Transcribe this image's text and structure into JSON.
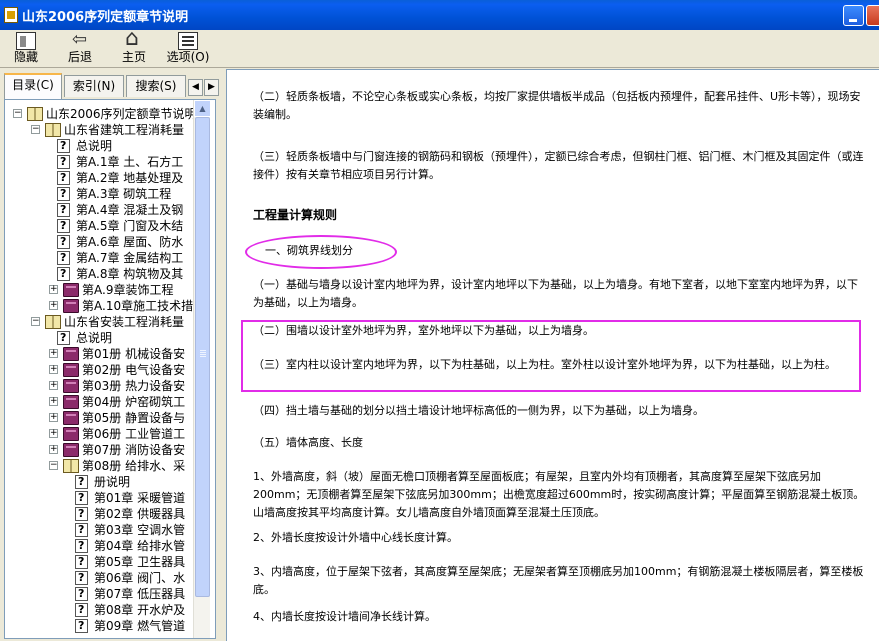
{
  "window": {
    "title": "山东2006序列定额章节说明"
  },
  "toolbar": [
    {
      "label": "隐藏",
      "icon": "hide-pane-icon"
    },
    {
      "label": "后退",
      "icon": "back-arrow-icon"
    },
    {
      "label": "主页",
      "icon": "home-icon"
    },
    {
      "label": "选项(O)",
      "icon": "options-icon"
    }
  ],
  "tabs": [
    {
      "label": "目录(C)",
      "active": true
    },
    {
      "label": "索引(N)",
      "active": false
    },
    {
      "label": "搜索(S)",
      "active": false
    }
  ],
  "tree": [
    {
      "label": "山东2006序列定额章节说明",
      "icon": "book-open",
      "expander": "-",
      "level": 0
    },
    {
      "label": "山东省建筑工程消耗量",
      "icon": "book-open",
      "expander": "-",
      "level": 1
    },
    {
      "label": "总说明",
      "icon": "page",
      "expander": "",
      "level": 2
    },
    {
      "label": "第A.1章 土、石方工",
      "icon": "page",
      "expander": "",
      "level": 2
    },
    {
      "label": "第A.2章 地基处理及",
      "icon": "page",
      "expander": "",
      "level": 2
    },
    {
      "label": "第A.3章 砌筑工程",
      "icon": "page",
      "expander": "",
      "level": 2,
      "selected": true
    },
    {
      "label": "第A.4章 混凝土及钢",
      "icon": "page",
      "expander": "",
      "level": 2
    },
    {
      "label": "第A.5章 门窗及木结",
      "icon": "page",
      "expander": "",
      "level": 2
    },
    {
      "label": "第A.6章 屋面、防水",
      "icon": "page",
      "expander": "",
      "level": 2
    },
    {
      "label": "第A.7章 金属结构工",
      "icon": "page",
      "expander": "",
      "level": 2
    },
    {
      "label": "第A.8章 构筑物及其",
      "icon": "page",
      "expander": "",
      "level": 2
    },
    {
      "label": "第A.9章装饰工程",
      "icon": "book-closed",
      "expander": "+",
      "level": 2
    },
    {
      "label": "第A.10章施工技术措",
      "icon": "book-closed",
      "expander": "+",
      "level": 2
    },
    {
      "label": "山东省安装工程消耗量",
      "icon": "book-open",
      "expander": "-",
      "level": 1
    },
    {
      "label": "总说明",
      "icon": "page",
      "expander": "",
      "level": 2
    },
    {
      "label": "第01册  机械设备安",
      "icon": "book-closed",
      "expander": "+",
      "level": 2
    },
    {
      "label": "第02册  电气设备安",
      "icon": "book-closed",
      "expander": "+",
      "level": 2
    },
    {
      "label": "第03册  热力设备安",
      "icon": "book-closed",
      "expander": "+",
      "level": 2
    },
    {
      "label": "第04册  炉窑砌筑工",
      "icon": "book-closed",
      "expander": "+",
      "level": 2
    },
    {
      "label": "第05册  静置设备与",
      "icon": "book-closed",
      "expander": "+",
      "level": 2
    },
    {
      "label": "第06册  工业管道工",
      "icon": "book-closed",
      "expander": "+",
      "level": 2
    },
    {
      "label": "第07册  消防设备安",
      "icon": "book-closed",
      "expander": "+",
      "level": 2
    },
    {
      "label": "第08册  给排水、采",
      "icon": "book-open",
      "expander": "-",
      "level": 2
    },
    {
      "label": "册说明",
      "icon": "page",
      "expander": "",
      "level": 3
    },
    {
      "label": "第01章  采暖管道",
      "icon": "page",
      "expander": "",
      "level": 3
    },
    {
      "label": "第02章  供暖器具",
      "icon": "page",
      "expander": "",
      "level": 3
    },
    {
      "label": "第03章  空调水管",
      "icon": "page",
      "expander": "",
      "level": 3
    },
    {
      "label": "第04章  给排水管",
      "icon": "page",
      "expander": "",
      "level": 3
    },
    {
      "label": "第05章  卫生器具",
      "icon": "page",
      "expander": "",
      "level": 3
    },
    {
      "label": "第06章  阀门、水",
      "icon": "page",
      "expander": "",
      "level": 3
    },
    {
      "label": "第07章  低压器具",
      "icon": "page",
      "expander": "",
      "level": 3
    },
    {
      "label": "第08章  开水炉及",
      "icon": "page",
      "expander": "",
      "level": 3
    },
    {
      "label": "第09章  燃气管道",
      "icon": "page",
      "expander": "",
      "level": 3
    }
  ],
  "content": {
    "p1": "（二）轻质条板墙，不论空心条板或实心条板，均按厂家提供墙板半成品（包括板内预埋件，配套吊挂件、U形卡等），现场安装编制。",
    "p2": "（三）轻质条板墙中与门窗连接的钢筋码和钢板（预埋件），定额已综合考虑，但钢柱门框、铝门框、木门框及其固定件（或连接件）按有关章节相应项目另行计算。",
    "heading": "工程量计算规则",
    "sub1": "一、砌筑界线划分",
    "p3": "（一）基础与墙身以设计室内地坪为界，设计室内地坪以下为基础，以上为墙身。有地下室者，以地下室室内地坪为界，以下为基础，以上为墙身。",
    "p4": "（二）围墙以设计室外地坪为界，室外地坪以下为基础，以上为墙身。",
    "p5": "（三）室内柱以设计室内地坪为界，以下为柱基础，以上为柱。室外柱以设计室外地坪为界，以下为柱基础，以上为柱。",
    "p6": "（四）挡土墙与基础的划分以挡土墙设计地坪标高低的一侧为界，以下为基础，以上为墙身。",
    "p7": "（五）墙体高度、长度",
    "p8": "1、外墙高度，斜（坡）屋面无檐口顶棚者算至屋面板底；有屋架，且室内外均有顶棚者，其高度算至屋架下弦底另加200mm；无顶棚者算至屋架下弦底另加300mm；出檐宽度超过600mm时，按实砌高度计算；平屋面算至钢筋混凝土板顶。山墙高度按其平均高度计算。女儿墙高度自外墙顶面算至混凝土压顶底。",
    "p9": "2、外墙长度按设计外墙中心线长度计算。",
    "p10": "3、内墙高度，位于屋架下弦者，其高度算至屋架底；无屋架者算至顶棚底另加100mm；有钢筋混凝土楼板隔层者，算至楼板底。",
    "p11": "4、内墙长度按设计墙间净长线计算。"
  },
  "annotation_color": "#e12ce8"
}
